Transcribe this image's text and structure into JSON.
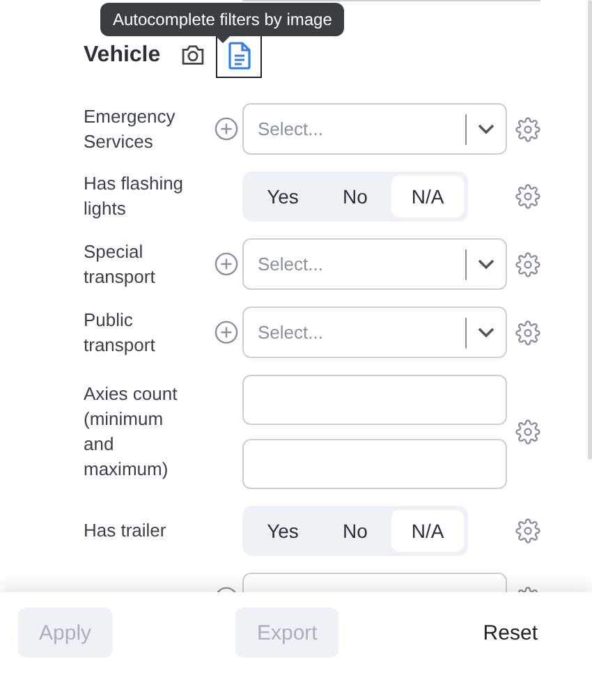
{
  "tooltip": {
    "text": "Autocomplete filters by image"
  },
  "section": {
    "title": "Vehicle",
    "image_icon_highlighted": true
  },
  "rows": [
    {
      "kind": "select",
      "label": "Emergency Services",
      "placeholder": "Select..."
    },
    {
      "kind": "toggle",
      "label": "Has flashing lights",
      "options": [
        {
          "label": "Yes",
          "selected": false
        },
        {
          "label": "No",
          "selected": false
        },
        {
          "label": "N/A",
          "selected": true
        }
      ]
    },
    {
      "kind": "select",
      "label": "Special transport",
      "placeholder": "Select..."
    },
    {
      "kind": "select",
      "label": "Public transport",
      "placeholder": "Select..."
    },
    {
      "kind": "range",
      "label": "Axies count (minimum and maximum)"
    },
    {
      "kind": "toggle",
      "label": "Has trailer",
      "options": [
        {
          "label": "Yes",
          "selected": false
        },
        {
          "label": "No",
          "selected": false
        },
        {
          "label": "N/A",
          "selected": true
        }
      ]
    }
  ],
  "footer": {
    "buttons": [
      {
        "label": "Apply",
        "disabled": true
      },
      {
        "label": "Export",
        "disabled": true
      },
      {
        "label": "Reset",
        "disabled": false
      }
    ]
  }
}
